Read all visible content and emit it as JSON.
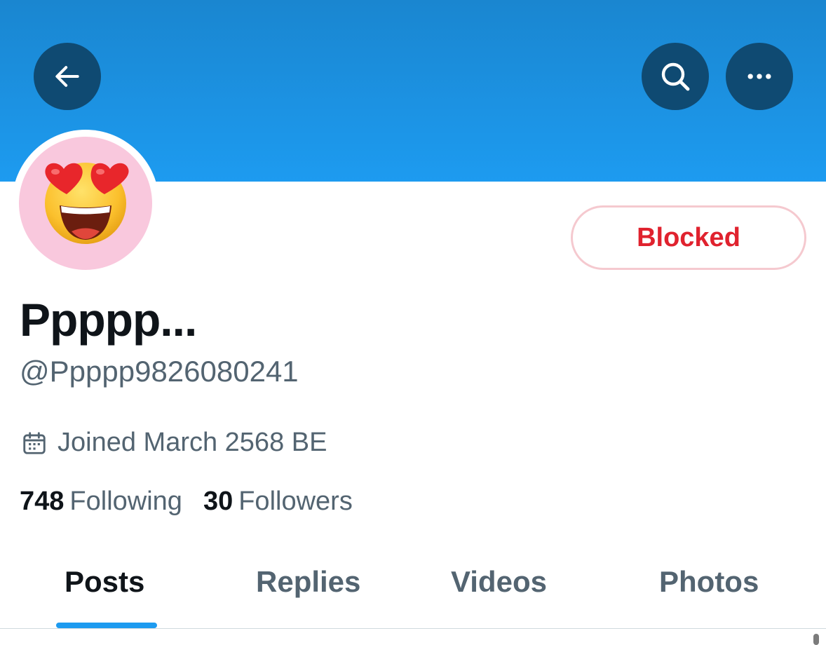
{
  "header": {
    "back_icon": "arrow-left-icon",
    "search_icon": "search-icon",
    "more_icon": "more-horizontal-icon",
    "banner_color": "#1d9bf0"
  },
  "profile": {
    "avatar_icon": "smiling-face-with-heart-eyes-emoji",
    "avatar_background": "#f9c8dd",
    "display_name": "Ppppp...",
    "handle": "@Ppppp9826080241",
    "joined_icon": "calendar-icon",
    "joined": "Joined March 2568 BE",
    "blocked_label": "Blocked",
    "following_count": "748",
    "following_label": "Following",
    "followers_count": "30",
    "followers_label": "Followers"
  },
  "tabs": [
    {
      "label": "Posts",
      "active": true
    },
    {
      "label": "Replies",
      "active": false
    },
    {
      "label": "Videos",
      "active": false
    },
    {
      "label": "Photos",
      "active": false
    }
  ]
}
